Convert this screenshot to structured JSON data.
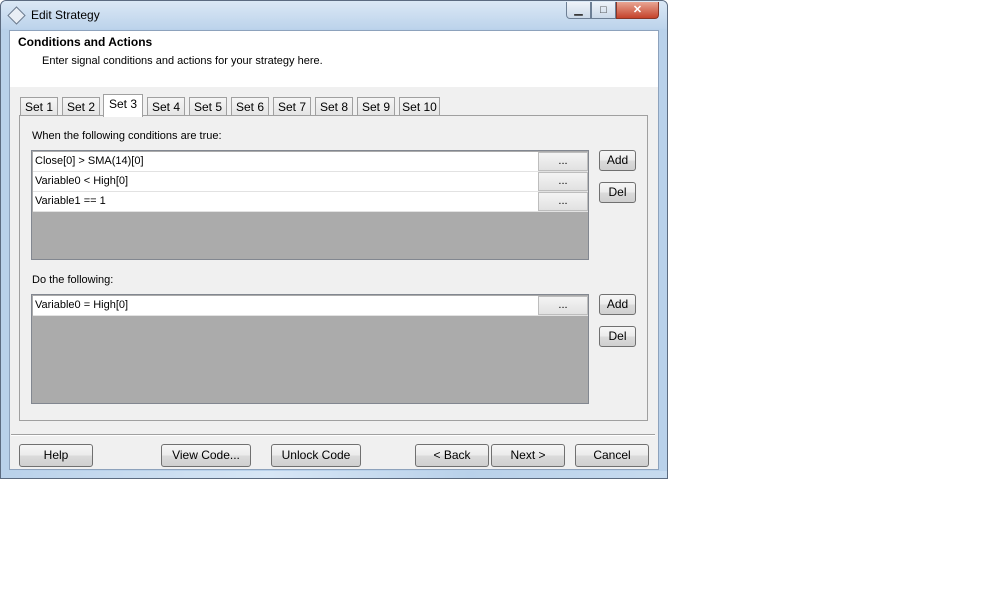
{
  "window": {
    "title": "Edit Strategy"
  },
  "caption_buttons": {
    "minimize": "▁",
    "maximize": "□",
    "close": "✕"
  },
  "header": {
    "title": "Conditions and Actions",
    "subtitle": "Enter signal conditions and actions for your strategy here."
  },
  "tabs": [
    {
      "label": "Set 1"
    },
    {
      "label": "Set 2"
    },
    {
      "label": "Set 3"
    },
    {
      "label": "Set 4"
    },
    {
      "label": "Set 5"
    },
    {
      "label": "Set 6"
    },
    {
      "label": "Set 7"
    },
    {
      "label": "Set 8"
    },
    {
      "label": "Set 9"
    },
    {
      "label": "Set 10"
    }
  ],
  "active_tab": "Set 3",
  "conditions": {
    "label": "When the following conditions are true:",
    "rows": [
      {
        "text": "Close[0] > SMA(14)[0]",
        "button": "..."
      },
      {
        "text": "Variable0 < High[0]",
        "button": "..."
      },
      {
        "text": "Variable1 == 1",
        "button": "..."
      }
    ],
    "add_label": "Add",
    "del_label": "Del"
  },
  "actions": {
    "label": "Do the following:",
    "rows": [
      {
        "text": "Variable0 = High[0]",
        "button": "..."
      }
    ],
    "add_label": "Add",
    "del_label": "Del"
  },
  "footer": {
    "help": "Help",
    "view_code": "View Code...",
    "unlock_code": "Unlock Code",
    "back": "< Back",
    "next": "Next >",
    "cancel": "Cancel"
  },
  "colors": {
    "accent": "#b9d1ea",
    "grid_background": "#ababab",
    "close_button": "#c5432b"
  }
}
